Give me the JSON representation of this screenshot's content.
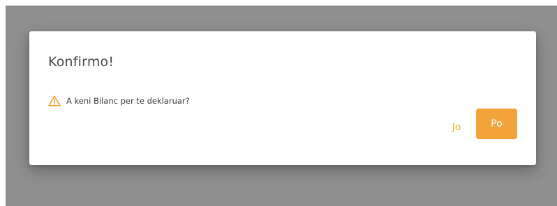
{
  "dialog": {
    "title": "Konfirmo!",
    "message": "A keni Bilanc per te deklaruar?",
    "icon": "warning-icon",
    "buttons": {
      "cancel_label": "Jo",
      "confirm_label": "Po"
    }
  },
  "colors": {
    "overlay": "#8f8f8f",
    "warning_icon": "#f2a33a",
    "cancel_text": "#e8b829",
    "confirm_background": "#f2a33a",
    "confirm_text": "#ffffff"
  }
}
